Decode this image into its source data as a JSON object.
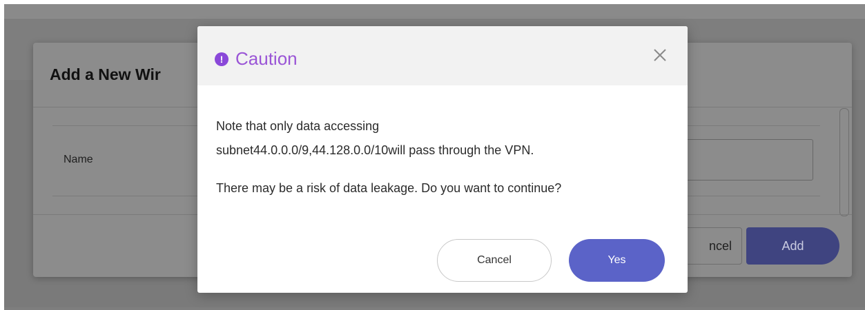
{
  "background_dialog": {
    "title": "Add a New Wir",
    "name_label": "Name",
    "cancel_label": "ncel",
    "add_label": "Add"
  },
  "caution_dialog": {
    "title": "Caution",
    "icon": "exclamation-circle-icon",
    "accent_color": "#9a55d6",
    "message_line1": "Note that only data accessing",
    "message_line2": "subnet44.0.0.0/9,44.128.0.0/10will pass through the VPN.",
    "message_line3": "There may be a risk of data leakage. Do you want to continue?",
    "cancel_label": "Cancel",
    "yes_label": "Yes",
    "primary_color": "#5b63c8"
  }
}
